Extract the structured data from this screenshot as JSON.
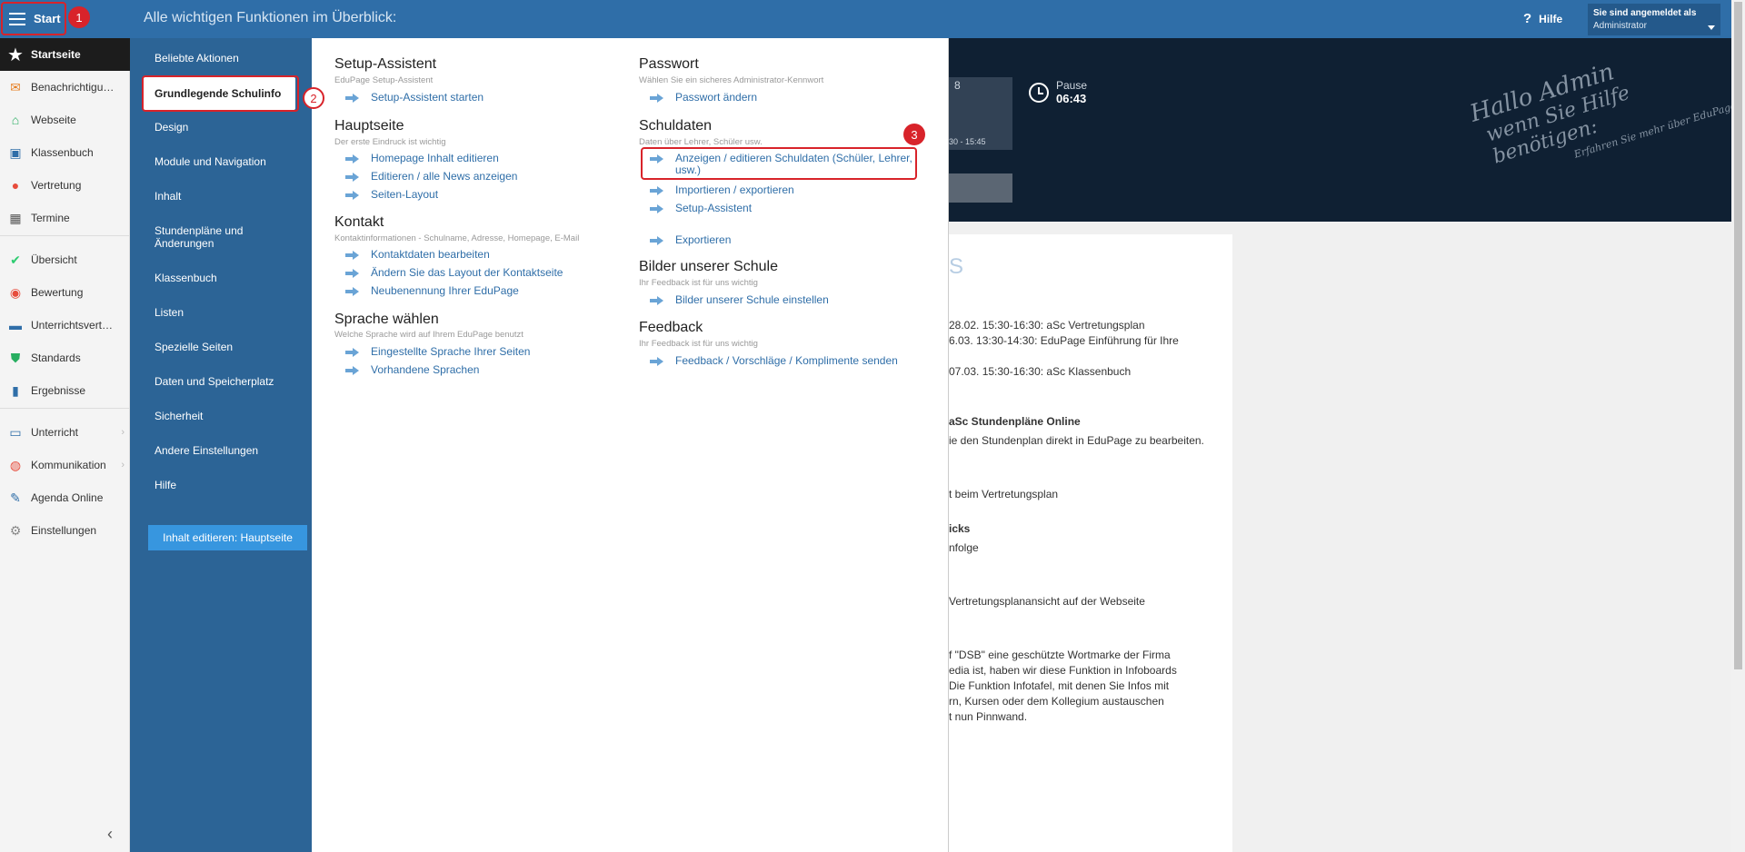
{
  "topbar": {
    "start_label": "Start",
    "menu_heading": "Alle wichtigen Funktionen im Überblick:",
    "help_label": "Hilfe",
    "user_line1": "Sie sind angemeldet als",
    "user_line2": "Administrator"
  },
  "sidebar": {
    "items": [
      {
        "label": "Startseite",
        "icon": "star-icon",
        "color": "#ffffff"
      },
      {
        "label": "Benachrichtigungen",
        "icon": "envelope-icon",
        "color": "#e67e22"
      },
      {
        "label": "Webseite",
        "icon": "home-icon",
        "color": "#27ae60"
      },
      {
        "label": "Klassenbuch",
        "icon": "book-icon",
        "color": "#2f6ea8"
      },
      {
        "label": "Vertretung",
        "icon": "person-icon",
        "color": "#e74c3c"
      },
      {
        "label": "Termine",
        "icon": "calendar-icon",
        "color": "#555555"
      },
      {
        "label": "Übersicht",
        "icon": "check-circle-icon",
        "color": "#2ecc71"
      },
      {
        "label": "Bewertung",
        "icon": "grade-icon",
        "color": "#e74c3c"
      },
      {
        "label": "Unterrichtsverteilung",
        "icon": "briefcase-icon",
        "color": "#2f6ea8"
      },
      {
        "label": "Standards",
        "icon": "shield-icon",
        "color": "#27ae60"
      },
      {
        "label": "Ergebnisse",
        "icon": "bar-chart-icon",
        "color": "#2f6ea8"
      },
      {
        "label": "Unterricht",
        "icon": "folder-icon",
        "color": "#2f6ea8"
      },
      {
        "label": "Kommunikation",
        "icon": "chat-icon",
        "color": "#e74c3c"
      },
      {
        "label": "Agenda Online",
        "icon": "pen-icon",
        "color": "#2f6ea8"
      },
      {
        "label": "Einstellungen",
        "icon": "gear-icon",
        "color": "#888888"
      }
    ]
  },
  "menu2": {
    "items": [
      "Beliebte Aktionen",
      "Grundlegende Schulinfo",
      "Design",
      "Module und Navigation",
      "Inhalt",
      "Stundenpläne und Änderungen",
      "Klassenbuch",
      "Listen",
      "Spezielle Seiten",
      "Daten und Speicherplatz",
      "Sicherheit",
      "Andere Einstellungen",
      "Hilfe"
    ],
    "edit_button": "Inhalt editieren: Hauptseite"
  },
  "menu3": {
    "left": [
      {
        "title": "Setup-Assistent",
        "subtitle": "EduPage Setup-Assistent",
        "links": [
          "Setup-Assistent starten"
        ]
      },
      {
        "title": "Hauptseite",
        "subtitle": "Der erste Eindruck ist wichtig",
        "links": [
          "Homepage Inhalt editieren",
          "Editieren / alle News anzeigen",
          "Seiten-Layout"
        ]
      },
      {
        "title": "Kontakt",
        "subtitle": "Kontaktinformationen - Schulname, Adresse, Homepage, E-Mail",
        "links": [
          "Kontaktdaten bearbeiten",
          "Ändern Sie das Layout der Kontaktseite",
          "Neubenennung Ihrer EduPage"
        ]
      },
      {
        "title": "Sprache wählen",
        "subtitle": "Welche Sprache wird auf Ihrem EduPage benutzt",
        "links": [
          "Eingestellte Sprache Ihrer Seiten",
          "Vorhandene Sprachen"
        ]
      }
    ],
    "right": [
      {
        "title": "Passwort",
        "subtitle": "Wählen Sie ein sicheres Administrator-Kennwort",
        "links": [
          "Passwort ändern"
        ]
      },
      {
        "title": "Schuldaten",
        "subtitle": "Daten über Lehrer, Schüler usw.",
        "links": [
          "Anzeigen / editieren Schuldaten (Schüler, Lehrer,",
          "usw.)",
          "Importieren / exportieren",
          "Setup-Assistent",
          "Exportieren"
        ]
      },
      {
        "title": "Bilder unserer Schule",
        "subtitle": "Ihr Feedback ist für uns wichtig",
        "links": [
          "Bilder unserer Schule einstellen"
        ]
      },
      {
        "title": "Feedback",
        "subtitle": "Ihr Feedback ist für uns wichtig",
        "links": [
          "Feedback / Vorschläge / Komplimente senden"
        ]
      }
    ]
  },
  "banner": {
    "period_number": "8",
    "period_time": "30 - 15:45",
    "pause_label": "Pause",
    "pause_time": "06:43",
    "hallo_line1": "Hallo Admin",
    "hallo_line2": "wenn Sie Hilfe benötigen:",
    "hallo_line3": "Erfahren Sie mehr über EduPage"
  },
  "content": {
    "heading": "S",
    "lines": [
      "28.02. 15:30-16:30: aSc Vertretungsplan",
      "6.03. 13:30-14:30: EduPage Einführung für Ihre",
      "07.03. 15:30-16:30: aSc Klassenbuch",
      "aSc Stundenpläne Online",
      "ie den Stundenplan direkt in EduPage zu bearbeiten.",
      "t beim Vertretungsplan",
      "icks",
      "nfolge",
      "Vertretungsplanansicht auf der Webseite",
      "f \"DSB\" eine geschützte Wortmarke der Firma",
      "edia ist, haben wir diese Funktion in Infoboards",
      "Die Funktion Infotafel, mit denen Sie Infos mit",
      "rn, Kursen oder dem Kollegium austauschen",
      "t nun Pinnwand."
    ]
  },
  "annotations": [
    "1",
    "2",
    "3"
  ]
}
